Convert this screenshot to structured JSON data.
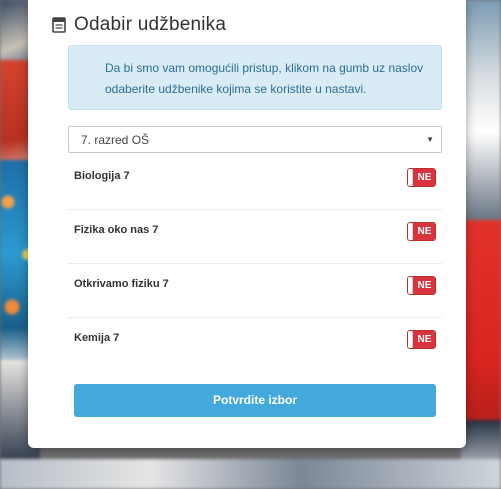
{
  "card": {
    "title": "Odabir udžbenika",
    "title_icon": "book-icon"
  },
  "info": {
    "text": "Da bi smo vam omogućili pristup, klikom na gumb uz naslov odaberite udžbenike kojima se koristite u nastavi."
  },
  "grade_select": {
    "selected": "7. razred OŠ"
  },
  "books": [
    {
      "label": "Biologija 7",
      "state": "NE"
    },
    {
      "label": "Fizika oko nas 7",
      "state": "NE"
    },
    {
      "label": "Otkrivamo fiziku 7",
      "state": "NE"
    },
    {
      "label": "Kemija 7",
      "state": "NE"
    }
  ],
  "submit": {
    "label": "Potvrdite izbor"
  },
  "colors": {
    "toggle_off": "#d9333f",
    "button": "#43a9dc",
    "info_bg": "#d9ebf5",
    "info_text": "#2c6e91"
  }
}
